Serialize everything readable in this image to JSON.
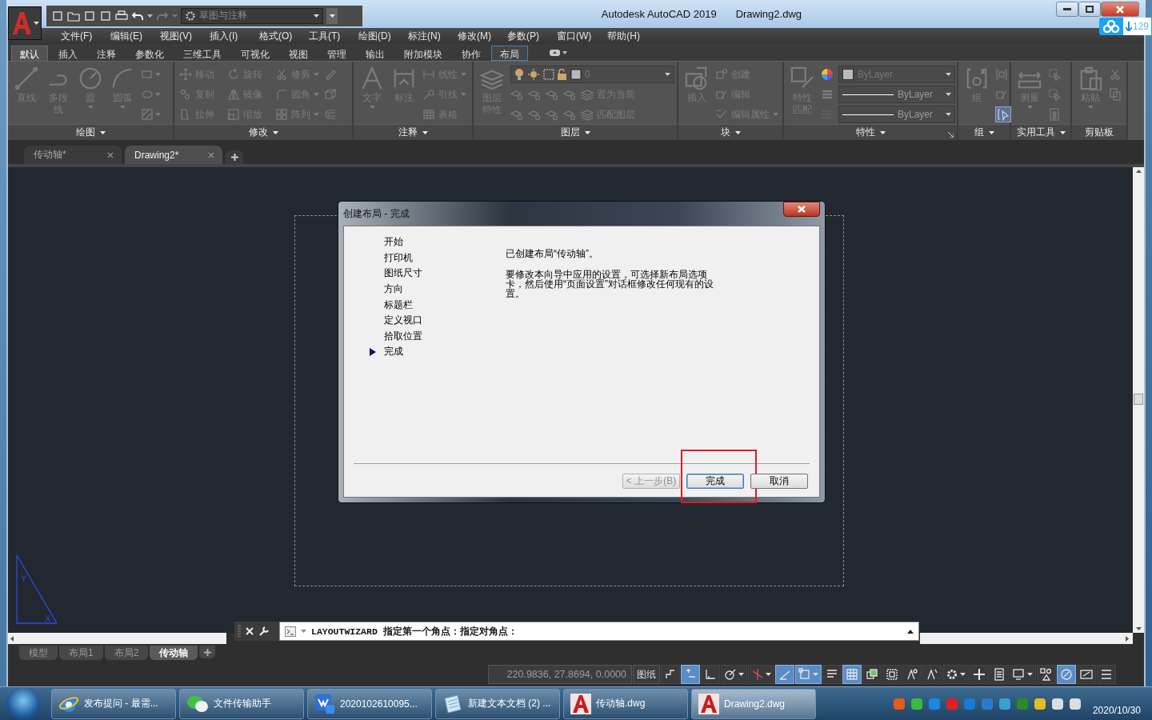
{
  "title_bar": {
    "workspace": "草图与注释",
    "app_name": "Autodesk AutoCAD 2019",
    "document": "Drawing2.dwg"
  },
  "cloud_badge": {
    "count": "129"
  },
  "menu_bar": [
    "文件(F)",
    "编辑(E)",
    "视图(V)",
    "插入(I)",
    "格式(O)",
    "工具(T)",
    "绘图(D)",
    "标注(N)",
    "修改(M)",
    "参数(P)",
    "窗口(W)",
    "帮助(H)"
  ],
  "ribbon": {
    "disabled": true,
    "tabs": [
      {
        "label": "默认",
        "selected": true,
        "contextual": false
      },
      {
        "label": "插入",
        "selected": false,
        "contextual": false
      },
      {
        "label": "注释",
        "selected": false,
        "contextual": false
      },
      {
        "label": "参数化",
        "selected": false,
        "contextual": false
      },
      {
        "label": "三维工具",
        "selected": false,
        "contextual": false
      },
      {
        "label": "可视化",
        "selected": false,
        "contextual": false
      },
      {
        "label": "视图",
        "selected": false,
        "contextual": false
      },
      {
        "label": "管理",
        "selected": false,
        "contextual": false
      },
      {
        "label": "输出",
        "selected": false,
        "contextual": false
      },
      {
        "label": "附加模块",
        "selected": false,
        "contextual": false
      },
      {
        "label": "协作",
        "selected": false,
        "contextual": false
      },
      {
        "label": "布局",
        "selected": false,
        "contextual": true
      }
    ],
    "panels": [
      {
        "title": "绘图",
        "expandable": true,
        "launcher": false,
        "items": [
          {
            "kind": "large",
            "label": "直线",
            "has_menu": false
          },
          {
            "kind": "large",
            "label": "多段线",
            "has_menu": false
          },
          {
            "kind": "large",
            "label": "圆",
            "has_menu": true
          },
          {
            "kind": "large",
            "label": "圆弧",
            "has_menu": true
          },
          {
            "kind": "stack",
            "rows": [
              [
                {
                  "kind": "icon",
                  "has_menu": true
                }
              ],
              [
                {
                  "kind": "icon",
                  "has_menu": true
                }
              ],
              [
                {
                  "kind": "icon",
                  "has_menu": true
                }
              ]
            ]
          }
        ]
      },
      {
        "title": "修改",
        "expandable": true,
        "launcher": false,
        "items": [
          {
            "kind": "stack",
            "rows": [
              [
                {
                  "kind": "small",
                  "label": "移动",
                  "has_menu": false
                },
                {
                  "kind": "small",
                  "label": "旋转",
                  "has_menu": false
                },
                {
                  "kind": "small",
                  "label": "修剪",
                  "has_menu": true
                },
                {
                  "kind": "icon",
                  "has_menu": false
                }
              ],
              [
                {
                  "kind": "small",
                  "label": "复制",
                  "has_menu": false
                },
                {
                  "kind": "small",
                  "label": "镜像",
                  "has_menu": false
                },
                {
                  "kind": "small",
                  "label": "圆角",
                  "has_menu": true
                },
                {
                  "kind": "icon",
                  "has_menu": false
                }
              ],
              [
                {
                  "kind": "small",
                  "label": "拉伸",
                  "has_menu": false
                },
                {
                  "kind": "small",
                  "label": "缩放",
                  "has_menu": false
                },
                {
                  "kind": "small",
                  "label": "阵列",
                  "has_menu": true
                },
                {
                  "kind": "icon",
                  "has_menu": false
                }
              ]
            ]
          }
        ]
      },
      {
        "title": "注释",
        "expandable": true,
        "launcher": false,
        "items": [
          {
            "kind": "large",
            "label": "文字",
            "has_menu": true
          },
          {
            "kind": "large",
            "label": "标注",
            "has_menu": false
          },
          {
            "kind": "stack",
            "rows": [
              [
                {
                  "kind": "small",
                  "label": "线性",
                  "has_menu": true
                }
              ],
              [
                {
                  "kind": "small",
                  "label": "引线",
                  "has_menu": true
                }
              ],
              [
                {
                  "kind": "small",
                  "label": "表格",
                  "has_menu": false
                }
              ]
            ]
          }
        ]
      },
      {
        "title": "图层",
        "expandable": true,
        "launcher": false,
        "items": [
          {
            "kind": "large",
            "label": "图层特性",
            "has_menu": false
          },
          {
            "kind": "stack",
            "rows": [
              [
                {
                  "kind": "layer-combo",
                  "value": "0"
                }
              ],
              [
                {
                  "kind": "icon",
                  "has_menu": false
                },
                {
                  "kind": "icon",
                  "has_menu": false
                },
                {
                  "kind": "icon",
                  "has_menu": false
                },
                {
                  "kind": "icon",
                  "has_menu": false
                },
                {
                  "kind": "small",
                  "label": "置为当前",
                  "has_menu": false
                }
              ],
              [
                {
                  "kind": "icon",
                  "has_menu": false
                },
                {
                  "kind": "icon",
                  "has_menu": false
                },
                {
                  "kind": "icon",
                  "has_menu": false
                },
                {
                  "kind": "icon",
                  "has_menu": false
                },
                {
                  "kind": "small",
                  "label": "匹配图层",
                  "has_menu": false
                }
              ]
            ]
          }
        ]
      },
      {
        "title": "块",
        "expandable": true,
        "launcher": false,
        "items": [
          {
            "kind": "large",
            "label": "插入",
            "has_menu": false
          },
          {
            "kind": "stack",
            "rows": [
              [
                {
                  "kind": "small",
                  "label": "创建",
                  "has_menu": false
                }
              ],
              [
                {
                  "kind": "small",
                  "label": "编辑",
                  "has_menu": false
                }
              ],
              [
                {
                  "kind": "small",
                  "label": "编辑属性",
                  "has_menu": true
                }
              ]
            ]
          }
        ]
      },
      {
        "title": "特性",
        "expandable": true,
        "launcher": true,
        "items": [
          {
            "kind": "large",
            "label": "特性匹配",
            "has_menu": false
          },
          {
            "kind": "stack",
            "rows": [
              [
                {
                  "kind": "icon",
                  "has_menu": false
                },
                {
                  "kind": "color-combo",
                  "value": "ByLayer"
                }
              ],
              [
                {
                  "kind": "icon",
                  "has_menu": false
                },
                {
                  "kind": "line-combo",
                  "value": "ByLayer"
                }
              ],
              [
                {
                  "kind": "icon",
                  "has_menu": false
                },
                {
                  "kind": "line-combo",
                  "value": "ByLayer"
                }
              ]
            ]
          }
        ]
      },
      {
        "title": "组",
        "expandable": true,
        "launcher": false,
        "items": [
          {
            "kind": "large",
            "label": "组",
            "has_menu": false
          },
          {
            "kind": "stack",
            "rows": [
              [
                {
                  "kind": "icon",
                  "has_menu": false,
                  "on": false
                }
              ],
              [
                {
                  "kind": "icon",
                  "has_menu": false,
                  "on": false
                }
              ],
              [
                {
                  "kind": "icon",
                  "has_menu": false,
                  "on": true
                }
              ]
            ]
          }
        ]
      },
      {
        "title": "实用工具",
        "expandable": true,
        "launcher": false,
        "items": [
          {
            "kind": "large",
            "label": "测量",
            "has_menu": true
          },
          {
            "kind": "stack",
            "rows": [
              [
                {
                  "kind": "icon",
                  "has_menu": false
                }
              ],
              [
                {
                  "kind": "icon",
                  "has_menu": false
                }
              ],
              [
                {
                  "kind": "icon",
                  "has_menu": false
                }
              ]
            ]
          }
        ]
      },
      {
        "title": "剪贴板",
        "expandable": false,
        "launcher": false,
        "items": [
          {
            "kind": "large",
            "label": "粘贴",
            "has_menu": true
          },
          {
            "kind": "stack",
            "rows": [
              [
                {
                  "kind": "icon",
                  "has_menu": false
                }
              ],
              [
                {
                  "kind": "icon",
                  "has_menu": false
                }
              ]
            ]
          }
        ]
      }
    ]
  },
  "file_tabs": [
    {
      "label": "传动轴*",
      "selected": false
    },
    {
      "label": "Drawing2*",
      "selected": true
    }
  ],
  "dialog": {
    "title": "创建布局 - 完成",
    "steps": [
      {
        "label": "开始",
        "current": false
      },
      {
        "label": "打印机",
        "current": false
      },
      {
        "label": "图纸尺寸",
        "current": false
      },
      {
        "label": "方向",
        "current": false
      },
      {
        "label": "标题栏",
        "current": false
      },
      {
        "label": "定义视口",
        "current": false
      },
      {
        "label": "拾取位置",
        "current": false
      },
      {
        "label": "完成",
        "current": true
      }
    ],
    "message": "已创建布局“传动轴”。",
    "details": "要修改本向导中应用的设置，可选择新布局选项卡，然后使用“页面设置”对话框修改任何现有的设置。",
    "buttons": [
      {
        "label": "< 上一步(B)",
        "disabled": true,
        "default": false,
        "highlighted": false
      },
      {
        "label": "完成",
        "disabled": false,
        "default": true,
        "highlighted": true
      },
      {
        "label": "取消",
        "disabled": false,
        "default": false,
        "highlighted": false
      }
    ]
  },
  "ucs": {
    "x_label": "X",
    "y_label": "Y"
  },
  "command_line": {
    "command": "LAYOUTWIZARD",
    "prompt": "指定第一个角点：指定对角点："
  },
  "layout_tabs": [
    {
      "label": "模型",
      "selected": false
    },
    {
      "label": "布局1",
      "selected": false
    },
    {
      "label": "布局2",
      "selected": false
    },
    {
      "label": "传动轴",
      "selected": true
    }
  ],
  "status_bar": {
    "coordinates": "220.9836, 27.8694, 0.0000",
    "space": "图纸",
    "toggles": [
      {
        "on": false,
        "has_menu": false
      },
      {
        "on": true,
        "has_menu": false
      },
      {
        "on": false,
        "has_menu": false
      },
      {
        "on": false,
        "has_menu": true
      },
      {
        "on": false,
        "has_menu": true
      },
      {
        "on": true,
        "has_menu": false
      },
      {
        "on": true,
        "has_menu": true
      },
      {
        "on": false,
        "has_menu": false
      },
      {
        "on": true,
        "has_menu": false
      },
      {
        "on": false,
        "has_menu": false
      },
      {
        "on": false,
        "has_menu": false
      },
      {
        "on": false,
        "has_menu": false
      },
      {
        "on": false,
        "has_menu": false
      },
      {
        "on": false,
        "has_menu": true
      },
      {
        "on": false,
        "has_menu": false
      },
      {
        "on": false,
        "has_menu": false
      },
      {
        "on": false,
        "has_menu": true
      },
      {
        "on": false,
        "has_menu": false
      },
      {
        "on": true,
        "has_menu": false
      },
      {
        "on": false,
        "has_menu": false
      },
      {
        "on": false,
        "has_menu": false
      }
    ]
  },
  "taskbar": {
    "items": [
      {
        "label": "发布提问 - 最需...",
        "active": false
      },
      {
        "label": "文件传输助手",
        "active": false
      },
      {
        "label": "2020102610095...",
        "active": false
      },
      {
        "label": "新建文本文档 (2) ...",
        "active": false
      },
      {
        "label": "传动轴.dwg",
        "active": false
      },
      {
        "label": "Drawing2.dwg",
        "active": true
      }
    ],
    "date": "2020/10/30"
  }
}
